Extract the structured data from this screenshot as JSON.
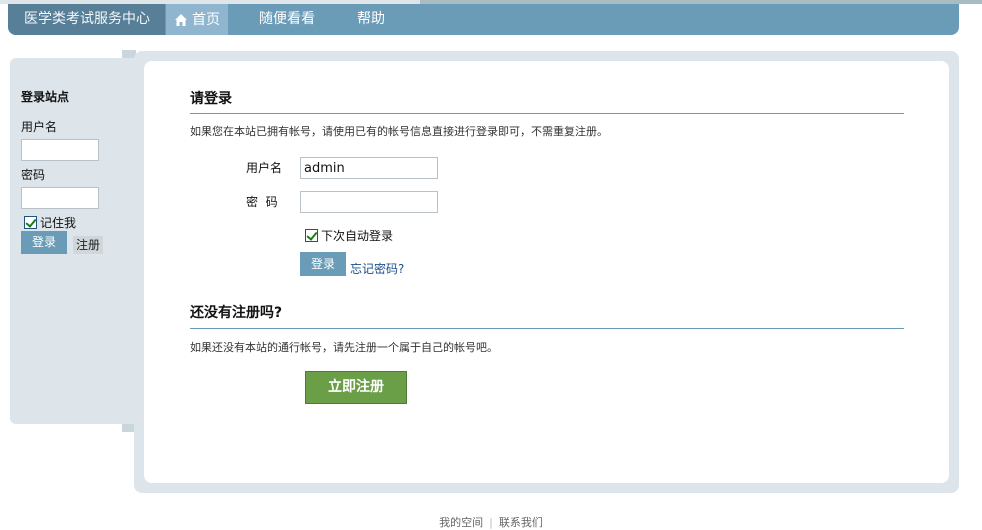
{
  "header": {
    "logo_text": "医学类考试服务中心",
    "nav": [
      {
        "label": "首页",
        "active": true,
        "icon": "home-icon"
      },
      {
        "label": "随便看看"
      },
      {
        "label": "帮助"
      }
    ]
  },
  "sidebar": {
    "title": "登录站点",
    "username_label": "用户名",
    "username_value": "",
    "password_label": "密码",
    "remember_label": "记住我",
    "remember_checked": true,
    "login_button": "登录",
    "register_button": "注册"
  },
  "login": {
    "title": "请登录",
    "description": "如果您在本站已拥有帐号，请使用已有的帐号信息直接进行登录即可，不需重复注册。",
    "username_label": "用户名",
    "username_value": "admin",
    "password_label": "密  码",
    "auto_login_label": "下次自动登录",
    "auto_login_checked": true,
    "login_button": "登录",
    "forgot_link": "忘记密码?"
  },
  "register": {
    "title": "还没有注册吗?",
    "description": "如果还没有本站的通行帐号，请先注册一个属于自己的帐号吧。",
    "button": "立即注册"
  },
  "footer": {
    "links": [
      "我的空间",
      "联系我们"
    ]
  },
  "colors": {
    "header_bg": "#6a9bb7",
    "logo_bg": "#577f98",
    "nav_active_bg": "#8fb6ce",
    "panel_bg": "#dde5ea",
    "register_btn_bg": "#6a9e47",
    "link": "#1a4f8a"
  }
}
